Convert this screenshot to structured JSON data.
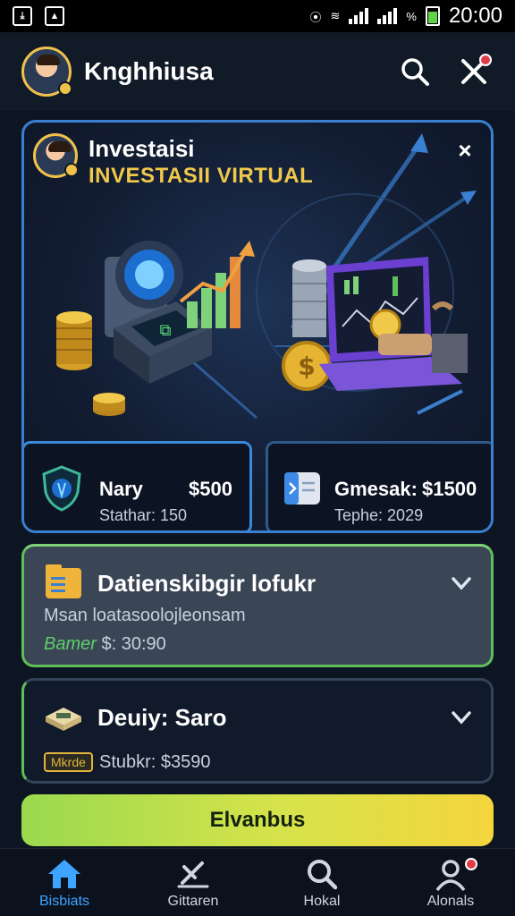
{
  "status_bar": {
    "time": "20:00",
    "battery_label": "%"
  },
  "header": {
    "title": "Knghhiusa"
  },
  "hero": {
    "title": "Investaisi",
    "subtitle": "INVESTASII VIRTUAL",
    "close_label": "×",
    "stats": [
      {
        "name": "Nary",
        "value": "$500",
        "sub": "Stathar: 150"
      },
      {
        "name": "Gmesak:",
        "value": "$1500",
        "sub": "Tephe: 2029"
      }
    ]
  },
  "items": [
    {
      "title": "Datienskibgir lofukr",
      "desc": "Msan loatasoolojleonsam",
      "tag": "Bamer",
      "line": "$: 30:90"
    },
    {
      "title": "Deuiy: Saro",
      "tag": "Mkrde",
      "line": "Stubkr: $3590"
    }
  ],
  "cta": {
    "label": "Elvanbus"
  },
  "nav": [
    {
      "label": "Bisbiats",
      "icon": "home-icon"
    },
    {
      "label": "Gittaren",
      "icon": "tools-icon"
    },
    {
      "label": "Hokal",
      "icon": "search-icon"
    },
    {
      "label": "Alonals",
      "icon": "profile-icon"
    }
  ],
  "colors": {
    "accent_blue": "#3a7fd0",
    "accent_gold": "#f0c84a",
    "accent_green": "#5fbf5a",
    "notification_red": "#e23b4a"
  }
}
